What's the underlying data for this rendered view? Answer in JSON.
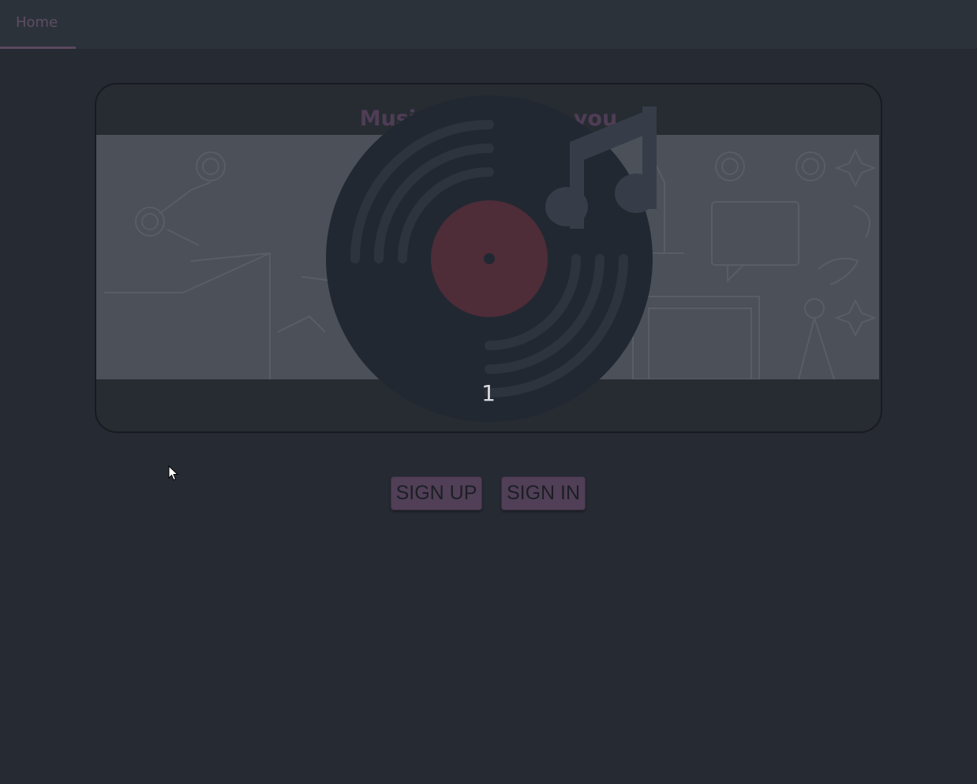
{
  "nav": {
    "tabs": [
      {
        "label": "Home",
        "active": true
      }
    ]
  },
  "hero": {
    "title": "Music for you, by you",
    "counter": "1",
    "icons": [
      "vinyl-record-icon",
      "music-note-icon"
    ]
  },
  "actions": {
    "signup_label": "SIGN UP",
    "signin_label": "SIGN IN"
  },
  "colors": {
    "background": "#262b33",
    "topbar": "#2c3239",
    "accent": "#503f57",
    "record": "#222831",
    "record_label": "#4e2d38",
    "banner": "#4b5059"
  }
}
